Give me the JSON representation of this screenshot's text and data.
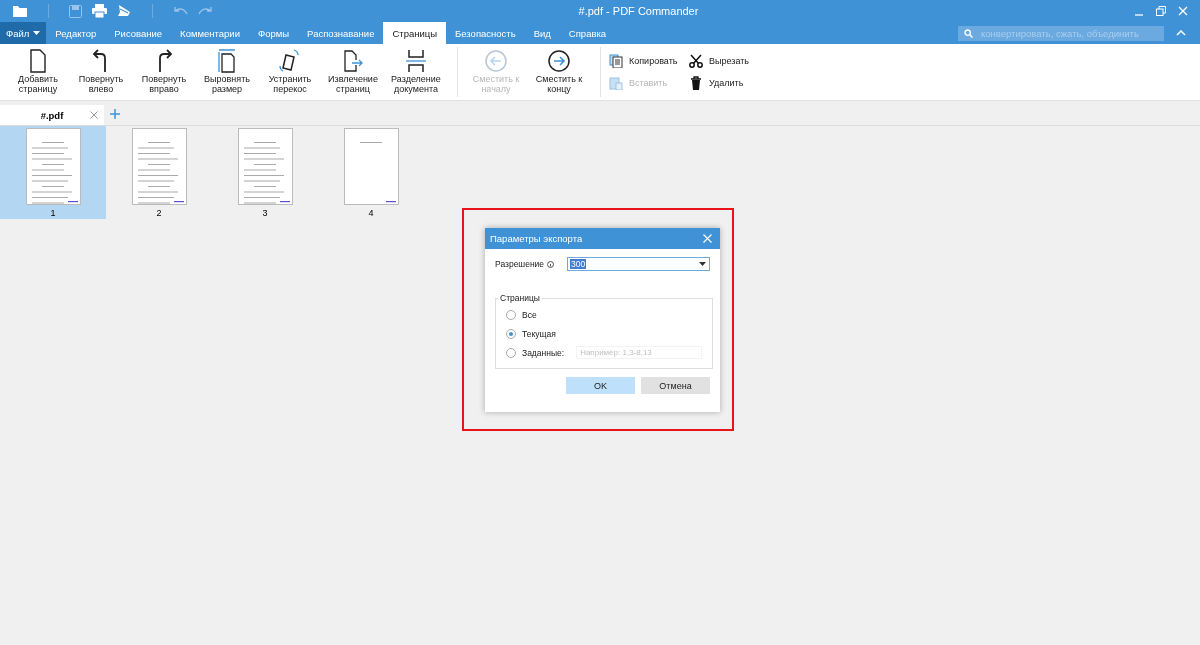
{
  "window": {
    "title": "#.pdf - PDF Commander"
  },
  "menu": [
    {
      "label": "Файл",
      "kind": "file"
    },
    {
      "label": "Редактор",
      "selected": false,
      "kind": "tab"
    },
    {
      "label": "Рисование",
      "selected": false,
      "kind": "tab"
    },
    {
      "label": "Комментарии",
      "selected": false,
      "kind": "tab"
    },
    {
      "label": "Формы",
      "selected": false,
      "kind": "tab"
    },
    {
      "label": "Распознавание",
      "selected": false,
      "kind": "tab"
    },
    {
      "label": "Страницы",
      "selected": true,
      "kind": "tab"
    },
    {
      "label": "Безопасность",
      "selected": false,
      "kind": "tab"
    },
    {
      "label": "Вид",
      "selected": false,
      "kind": "tab"
    },
    {
      "label": "Справка",
      "selected": false,
      "kind": "tab"
    }
  ],
  "search": {
    "placeholder": "конвертировать, сжать, объединить"
  },
  "ribbon": {
    "large": [
      {
        "label": "Добавить страницу",
        "disabled": false
      },
      {
        "label": "Повернуть влево",
        "disabled": false
      },
      {
        "label": "Повернуть вправо",
        "disabled": false
      },
      {
        "label": "Выровнять размер",
        "disabled": false
      },
      {
        "label": "Устранить перекос",
        "disabled": false
      },
      {
        "label": "Извлечение страниц",
        "disabled": false
      },
      {
        "label": "Разделение документа",
        "disabled": false
      },
      {
        "label": "Сместить к началу",
        "disabled": true
      },
      {
        "label": "Сместить к концу",
        "disabled": false
      }
    ],
    "small": [
      {
        "label": "Копировать",
        "disabled": false
      },
      {
        "label": "Вставить",
        "disabled": true
      },
      {
        "label": "Вырезать",
        "disabled": false
      },
      {
        "label": "Удалить",
        "disabled": false
      }
    ]
  },
  "document_tabs": [
    {
      "label": "#.pdf",
      "selected": true
    }
  ],
  "pages": [
    {
      "label": "1",
      "selected": true
    },
    {
      "label": "2",
      "selected": false
    },
    {
      "label": "3",
      "selected": false
    },
    {
      "label": "4",
      "selected": false
    }
  ],
  "dialog": {
    "title": "Параметры экспорта",
    "resolution_label": "Разрешение",
    "resolution_value": "300",
    "group_label": "Страницы",
    "options": [
      {
        "label": "Все",
        "selected": false
      },
      {
        "label": "Текущая",
        "selected": true
      },
      {
        "label": "Заданные:",
        "selected": false
      }
    ],
    "range_placeholder": "Например: 1,3-8,13",
    "buttons": [
      {
        "label": "OK",
        "kind": "primary"
      },
      {
        "label": "Отмена",
        "kind": "secondary"
      }
    ]
  }
}
